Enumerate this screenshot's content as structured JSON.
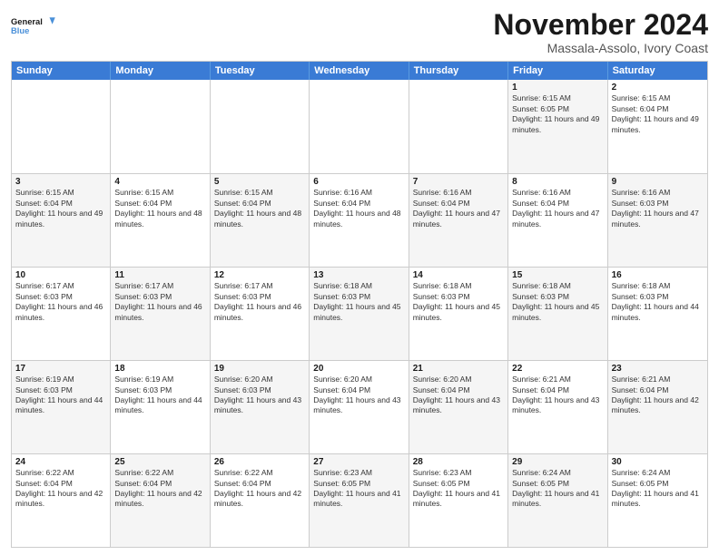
{
  "logo": {
    "line1": "General",
    "line2": "Blue"
  },
  "title": "November 2024",
  "location": "Massala-Assolo, Ivory Coast",
  "days": [
    "Sunday",
    "Monday",
    "Tuesday",
    "Wednesday",
    "Thursday",
    "Friday",
    "Saturday"
  ],
  "rows": [
    [
      {
        "day": "",
        "info": "",
        "shade": false
      },
      {
        "day": "",
        "info": "",
        "shade": false
      },
      {
        "day": "",
        "info": "",
        "shade": false
      },
      {
        "day": "",
        "info": "",
        "shade": false
      },
      {
        "day": "",
        "info": "",
        "shade": false
      },
      {
        "day": "1",
        "info": "Sunrise: 6:15 AM\nSunset: 6:05 PM\nDaylight: 11 hours and 49 minutes.",
        "shade": true
      },
      {
        "day": "2",
        "info": "Sunrise: 6:15 AM\nSunset: 6:04 PM\nDaylight: 11 hours and 49 minutes.",
        "shade": false
      }
    ],
    [
      {
        "day": "3",
        "info": "Sunrise: 6:15 AM\nSunset: 6:04 PM\nDaylight: 11 hours and 49 minutes.",
        "shade": true
      },
      {
        "day": "4",
        "info": "Sunrise: 6:15 AM\nSunset: 6:04 PM\nDaylight: 11 hours and 48 minutes.",
        "shade": false
      },
      {
        "day": "5",
        "info": "Sunrise: 6:15 AM\nSunset: 6:04 PM\nDaylight: 11 hours and 48 minutes.",
        "shade": true
      },
      {
        "day": "6",
        "info": "Sunrise: 6:16 AM\nSunset: 6:04 PM\nDaylight: 11 hours and 48 minutes.",
        "shade": false
      },
      {
        "day": "7",
        "info": "Sunrise: 6:16 AM\nSunset: 6:04 PM\nDaylight: 11 hours and 47 minutes.",
        "shade": true
      },
      {
        "day": "8",
        "info": "Sunrise: 6:16 AM\nSunset: 6:04 PM\nDaylight: 11 hours and 47 minutes.",
        "shade": false
      },
      {
        "day": "9",
        "info": "Sunrise: 6:16 AM\nSunset: 6:03 PM\nDaylight: 11 hours and 47 minutes.",
        "shade": true
      }
    ],
    [
      {
        "day": "10",
        "info": "Sunrise: 6:17 AM\nSunset: 6:03 PM\nDaylight: 11 hours and 46 minutes.",
        "shade": false
      },
      {
        "day": "11",
        "info": "Sunrise: 6:17 AM\nSunset: 6:03 PM\nDaylight: 11 hours and 46 minutes.",
        "shade": true
      },
      {
        "day": "12",
        "info": "Sunrise: 6:17 AM\nSunset: 6:03 PM\nDaylight: 11 hours and 46 minutes.",
        "shade": false
      },
      {
        "day": "13",
        "info": "Sunrise: 6:18 AM\nSunset: 6:03 PM\nDaylight: 11 hours and 45 minutes.",
        "shade": true
      },
      {
        "day": "14",
        "info": "Sunrise: 6:18 AM\nSunset: 6:03 PM\nDaylight: 11 hours and 45 minutes.",
        "shade": false
      },
      {
        "day": "15",
        "info": "Sunrise: 6:18 AM\nSunset: 6:03 PM\nDaylight: 11 hours and 45 minutes.",
        "shade": true
      },
      {
        "day": "16",
        "info": "Sunrise: 6:18 AM\nSunset: 6:03 PM\nDaylight: 11 hours and 44 minutes.",
        "shade": false
      }
    ],
    [
      {
        "day": "17",
        "info": "Sunrise: 6:19 AM\nSunset: 6:03 PM\nDaylight: 11 hours and 44 minutes.",
        "shade": true
      },
      {
        "day": "18",
        "info": "Sunrise: 6:19 AM\nSunset: 6:03 PM\nDaylight: 11 hours and 44 minutes.",
        "shade": false
      },
      {
        "day": "19",
        "info": "Sunrise: 6:20 AM\nSunset: 6:03 PM\nDaylight: 11 hours and 43 minutes.",
        "shade": true
      },
      {
        "day": "20",
        "info": "Sunrise: 6:20 AM\nSunset: 6:04 PM\nDaylight: 11 hours and 43 minutes.",
        "shade": false
      },
      {
        "day": "21",
        "info": "Sunrise: 6:20 AM\nSunset: 6:04 PM\nDaylight: 11 hours and 43 minutes.",
        "shade": true
      },
      {
        "day": "22",
        "info": "Sunrise: 6:21 AM\nSunset: 6:04 PM\nDaylight: 11 hours and 43 minutes.",
        "shade": false
      },
      {
        "day": "23",
        "info": "Sunrise: 6:21 AM\nSunset: 6:04 PM\nDaylight: 11 hours and 42 minutes.",
        "shade": true
      }
    ],
    [
      {
        "day": "24",
        "info": "Sunrise: 6:22 AM\nSunset: 6:04 PM\nDaylight: 11 hours and 42 minutes.",
        "shade": false
      },
      {
        "day": "25",
        "info": "Sunrise: 6:22 AM\nSunset: 6:04 PM\nDaylight: 11 hours and 42 minutes.",
        "shade": true
      },
      {
        "day": "26",
        "info": "Sunrise: 6:22 AM\nSunset: 6:04 PM\nDaylight: 11 hours and 42 minutes.",
        "shade": false
      },
      {
        "day": "27",
        "info": "Sunrise: 6:23 AM\nSunset: 6:05 PM\nDaylight: 11 hours and 41 minutes.",
        "shade": true
      },
      {
        "day": "28",
        "info": "Sunrise: 6:23 AM\nSunset: 6:05 PM\nDaylight: 11 hours and 41 minutes.",
        "shade": false
      },
      {
        "day": "29",
        "info": "Sunrise: 6:24 AM\nSunset: 6:05 PM\nDaylight: 11 hours and 41 minutes.",
        "shade": true
      },
      {
        "day": "30",
        "info": "Sunrise: 6:24 AM\nSunset: 6:05 PM\nDaylight: 11 hours and 41 minutes.",
        "shade": false
      }
    ]
  ]
}
